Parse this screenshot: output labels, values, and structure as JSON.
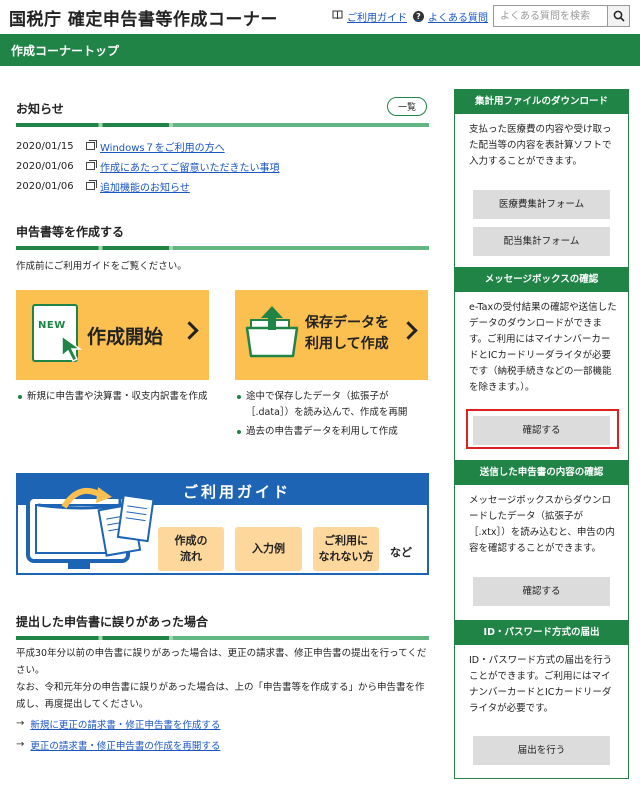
{
  "header": {
    "site_title": "国税庁 確定申告書等作成コーナー",
    "guide_link": "ご利用ガイド",
    "faq_link": "よくある質問",
    "search_placeholder": "よくある質問を検索"
  },
  "page_title": "作成コーナートップ",
  "news": {
    "heading": "お知らせ",
    "list_button": "一覧",
    "items": [
      {
        "date": "2020/01/15",
        "text": "Windows７をご利用の方へ"
      },
      {
        "date": "2020/01/06",
        "text": "作成にあたってご留意いただきたい事項"
      },
      {
        "date": "2020/01/06",
        "text": "追加機能のお知らせ"
      }
    ]
  },
  "create": {
    "heading": "申告書等を作成する",
    "note": "作成前にご利用ガイドをご覧ください。",
    "tile_new": {
      "tag": "NEW",
      "label": "作成開始"
    },
    "tile_resume": {
      "label_line1": "保存データを",
      "label_line2": "利用して作成"
    },
    "bullets_new": [
      "新規に申告書や決算書・収支内訳書を作成"
    ],
    "bullets_resume": [
      "途中で保存したデータ（拡張子が［.data］）を読み込んで、作成を再開",
      "過去の申告書データを利用して作成"
    ]
  },
  "guide": {
    "title": "ご利用ガイド",
    "btn1": "作成の\n流れ",
    "btn2": "入力例",
    "btn3": "ご利用に\nなれない方",
    "etc": "など"
  },
  "mistake": {
    "heading": "提出した申告書に誤りがあった場合",
    "text1": "平成30年分以前の申告書に誤りがあった場合は、更正の請求書、修正申告書の提出を行ってください。",
    "text2": "なお、令和元年分の申告書に誤りがあった場合は、上の「申告書等を作成する」から申告書を作成し、再度提出してください。",
    "links": [
      "新規に更正の請求書・修正申告書を作成する",
      "更正の請求書・修正申告書の作成を再開する"
    ]
  },
  "sidebar": {
    "download": {
      "heading": "集計用ファイルのダウンロード",
      "text": "支払った医療費の内容や受け取った配当等の内容を表計算ソフトで入力することができます。",
      "btn1": "医療費集計フォーム",
      "btn2": "配当集計フォーム"
    },
    "messagebox": {
      "heading": "メッセージボックスの確認",
      "text": "e-Taxの受付結果の確認や送信したデータのダウンロードができます。ご利用にはマイナンバーカードとICカードリーダライタが必要です（納税手続きなどの一部機能を除きます。）。",
      "btn": "確認する"
    },
    "sent": {
      "heading": "送信した申告書の内容の確認",
      "text": "メッセージボックスからダウンロードしたデータ（拡張子が［.xtx］）を読み込むと、申告の内容を確認することができます。",
      "btn": "確認する"
    },
    "idpw": {
      "heading": "ID・パスワード方式の届出",
      "text": "ID・パスワード方式の届出を行うことができます。ご利用にはマイナンバーカードとICカードリーダライタが必要です。",
      "btn": "届出を行う"
    }
  }
}
